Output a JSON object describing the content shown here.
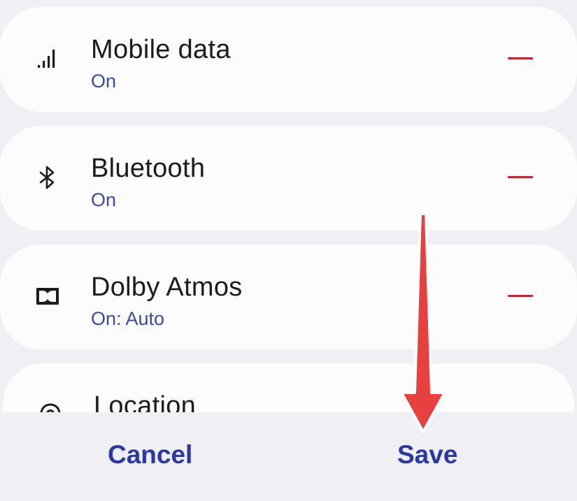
{
  "quick_panel_edit": {
    "items": [
      {
        "title": "Mobile data",
        "status": "On",
        "icon": "signal-bars-icon"
      },
      {
        "title": "Bluetooth",
        "status": "On",
        "icon": "bluetooth-icon"
      },
      {
        "title": "Dolby Atmos",
        "status": "On: Auto",
        "icon": "dolby-icon"
      },
      {
        "title": "Location",
        "status": "",
        "icon": "location-icon"
      }
    ],
    "remove_icon": "minus-icon"
  },
  "footer": {
    "cancel_label": "Cancel",
    "save_label": "Save"
  },
  "annotation": {
    "arrow_direction": "down",
    "arrow_color": "#e8403f"
  },
  "colors": {
    "accent_text": "#2a37a6",
    "status_text": "#3a4aa8",
    "remove_red": "#c4262a",
    "background": "#f0f0f4",
    "card": "#fcfcfd"
  }
}
